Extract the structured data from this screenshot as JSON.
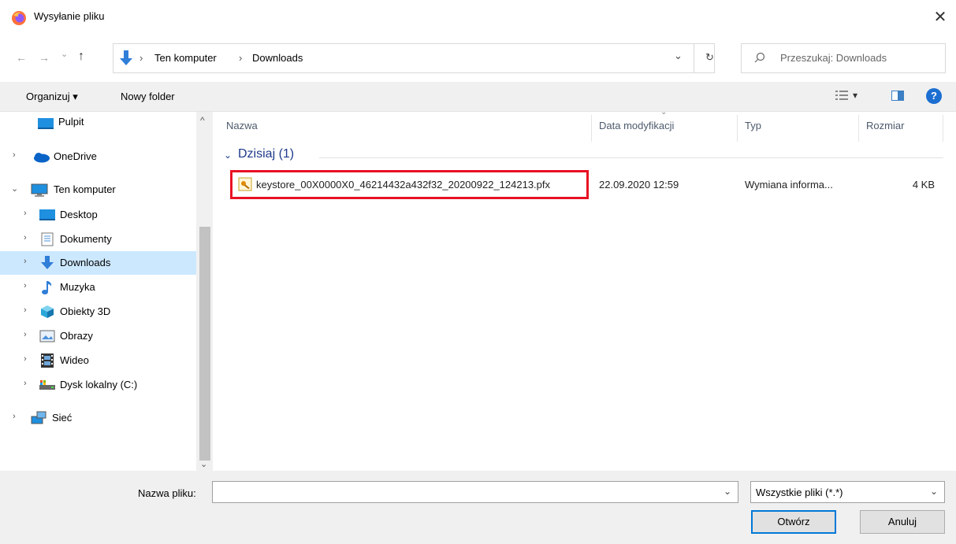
{
  "window": {
    "title": "Wysyłanie pliku",
    "close_glyph": "✕"
  },
  "nav": {
    "back_glyph": "←",
    "forward_glyph": "→",
    "history_glyph": "⌄",
    "up_glyph": "↑",
    "breadcrumb": [
      "Ten komputer",
      "Downloads"
    ],
    "separator": "›",
    "refresh_glyph": "↻",
    "dropdown_glyph": "⌄",
    "search_placeholder": "Przeszukaj: Downloads"
  },
  "toolbar": {
    "organize": "Organizuj ▾",
    "new_folder": "Nowy folder",
    "view_glyph": "▾",
    "help": "?"
  },
  "sidebar": {
    "items": [
      {
        "label": "Pulpit",
        "icon": "desktop-icon",
        "chevron": ""
      },
      {
        "label": "OneDrive",
        "icon": "cloud-icon",
        "chevron": "›"
      },
      {
        "label": "Ten komputer",
        "icon": "computer-icon",
        "chevron": "⌄"
      },
      {
        "label": "Desktop",
        "icon": "desktop-icon",
        "chevron": "›"
      },
      {
        "label": "Dokumenty",
        "icon": "documents-icon",
        "chevron": "›"
      },
      {
        "label": "Downloads",
        "icon": "downloads-icon",
        "chevron": "›",
        "selected": true
      },
      {
        "label": "Muzyka",
        "icon": "music-icon",
        "chevron": "›"
      },
      {
        "label": "Obiekty 3D",
        "icon": "objects-3d-icon",
        "chevron": "›"
      },
      {
        "label": "Obrazy",
        "icon": "pictures-icon",
        "chevron": "›"
      },
      {
        "label": "Wideo",
        "icon": "video-icon",
        "chevron": "›"
      },
      {
        "label": "Dysk lokalny (C:)",
        "icon": "drive-icon",
        "chevron": "›"
      },
      {
        "label": "Sieć",
        "icon": "network-icon",
        "chevron": "›"
      }
    ],
    "scroll_up": "^",
    "scroll_down": "⌄"
  },
  "columns": {
    "name": "Nazwa",
    "date": "Data modyfikacji",
    "type": "Typ",
    "size": "Rozmiar"
  },
  "group": {
    "label": "Dzisiaj (1)",
    "chevron": "⌄"
  },
  "files": [
    {
      "name": "keystore_00X0000X0_46214432a432f32_20200922_124213.pfx",
      "date": "22.09.2020 12:59",
      "type": "Wymiana informa...",
      "size": "4 KB"
    }
  ],
  "bottom": {
    "filename_label": "Nazwa pliku:",
    "filename_value": "",
    "filter_label": "Wszystkie pliki (*.*)",
    "open_button": "Otwórz",
    "cancel_button": "Anuluj"
  },
  "colors": {
    "selection": "#cce8ff",
    "highlight_box": "#e81123",
    "link_blue": "#1e3a8a"
  }
}
